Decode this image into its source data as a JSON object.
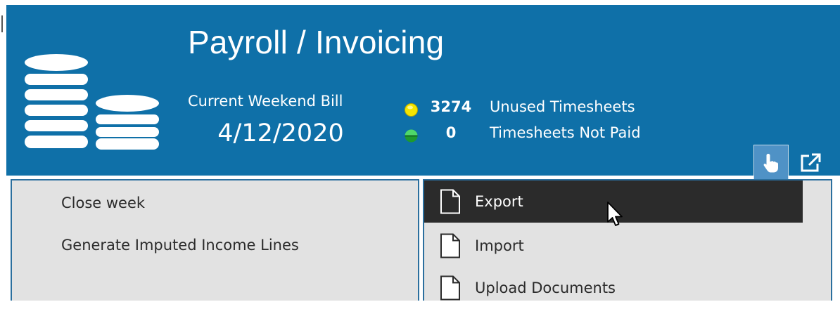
{
  "header": {
    "title": "Payroll / Invoicing",
    "bill_label": "Current Weekend Bill",
    "bill_date": "4/12/2020",
    "stats": [
      {
        "count": "3274",
        "label": "Unused Timesheets",
        "indicator": "yellow",
        "color": "#f4e400"
      },
      {
        "count": "0",
        "label": "Timesheets Not Paid",
        "indicator": "green-half",
        "color": "#1e9a2e"
      }
    ],
    "buttons": [
      {
        "icon": "touch-hand-icon",
        "state": "active"
      },
      {
        "icon": "popout-icon"
      }
    ]
  },
  "left_menu": {
    "items": [
      {
        "label": "Close week"
      },
      {
        "label": "Generate Imputed Income Lines"
      }
    ]
  },
  "right_menu": {
    "items": [
      {
        "label": "Export",
        "icon": "document-icon",
        "highlighted": true
      },
      {
        "label": "Import",
        "icon": "document-icon"
      },
      {
        "label": "Upload Documents",
        "icon": "document-icon"
      }
    ]
  },
  "colors": {
    "header_bg": "#0f70a8",
    "panel_bg": "#e2e2e2",
    "panel_border": "#2b6f9e",
    "highlight_bg": "#2b2b2b"
  }
}
